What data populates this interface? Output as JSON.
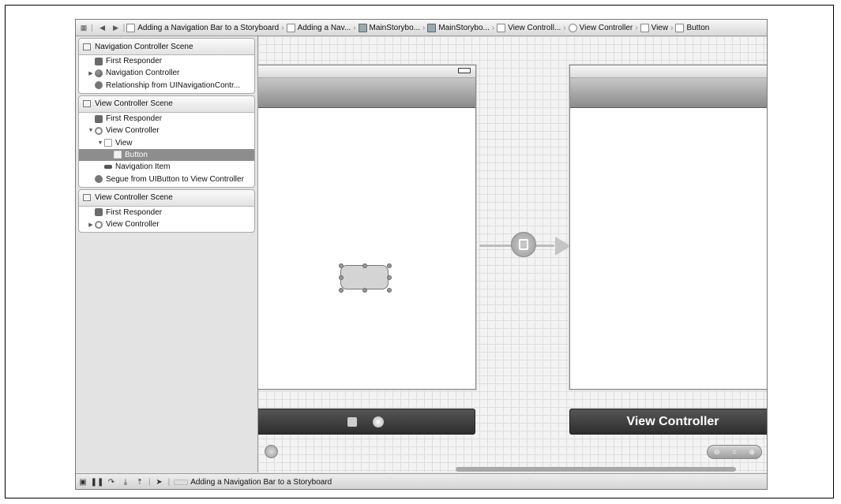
{
  "jumpbar": {
    "crumbs": [
      "Adding a Navigation Bar to a Storyboard",
      "Adding a Nav...",
      "MainStorybo...",
      "MainStorybo...",
      "View Controll...",
      "View Controller",
      "View",
      "Button"
    ]
  },
  "outline": {
    "scenes": [
      {
        "title": "Navigation Controller Scene",
        "rows": [
          "First Responder",
          "Navigation Controller",
          "Relationship from UINavigationContr..."
        ]
      },
      {
        "title": "View Controller Scene",
        "rows": [
          "First Responder",
          "View Controller",
          "View",
          "Button",
          "Navigation Item",
          "Segue from UIButton to View Controller"
        ]
      },
      {
        "title": "View Controller Scene",
        "rows": [
          "First Responder",
          "View Controller"
        ]
      }
    ],
    "selected_row": "Button"
  },
  "canvas": {
    "right_dock_label": "View Controller"
  },
  "debugbar": {
    "target_label": "Adding a Navigation Bar to a Storyboard"
  },
  "icons": [
    "grid-icon",
    "back-arrow-icon",
    "forward-arrow-icon",
    "storyboard-icon",
    "folder-icon",
    "file-icon",
    "view-controller-icon",
    "view-icon",
    "button-icon",
    "first-responder-icon",
    "navigation-controller-icon",
    "segue-icon",
    "zoom-icon",
    "battery-icon"
  ]
}
